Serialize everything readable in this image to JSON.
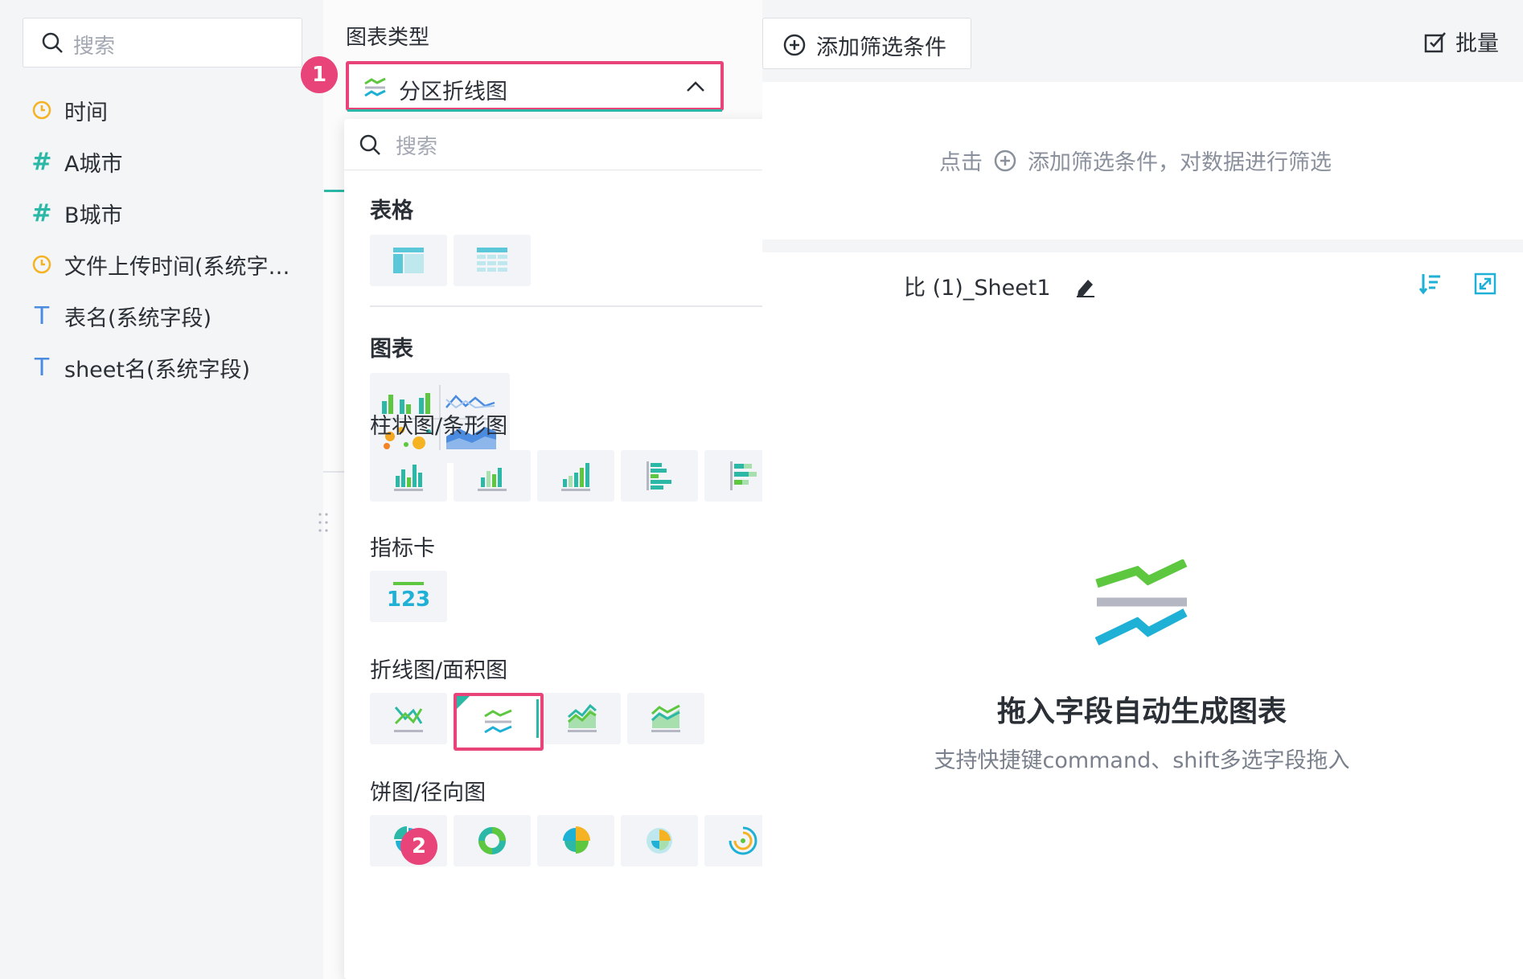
{
  "field_panel": {
    "search_placeholder": "搜索",
    "fields": [
      {
        "label": "时间",
        "icon": "clock-icon",
        "type": "date"
      },
      {
        "label": "A城市",
        "icon": "hash-icon",
        "type": "number"
      },
      {
        "label": "B城市",
        "icon": "hash-icon",
        "type": "number"
      },
      {
        "label": "文件上传时间(系统字…",
        "icon": "clock-icon",
        "type": "date"
      },
      {
        "label": "表名(系统字段)",
        "icon": "text-icon",
        "type": "text"
      },
      {
        "label": "sheet名(系统字段)",
        "icon": "text-icon",
        "type": "text"
      }
    ]
  },
  "chart_type": {
    "label": "图表类型",
    "selected": "分区折线图",
    "step1_badge": "1",
    "step2_badge": "2"
  },
  "dropdown": {
    "search_placeholder": "搜索",
    "sections": {
      "table": "表格",
      "chart": "图表",
      "bar": "柱状图/条形图",
      "kpi": "指标卡",
      "line": "折线图/面积图",
      "pie": "饼图/径向图"
    },
    "kpi_tile_text": "123"
  },
  "toolbar": {
    "add_filter": "添加筛选条件",
    "batch": "批量"
  },
  "filter_hint": {
    "prefix": "点击",
    "suffix": "添加筛选条件，对数据进行筛选"
  },
  "canvas": {
    "sheet_title": "比 (1)_Sheet1",
    "empty_title": "拖入字段自动生成图表",
    "empty_subtitle": "支持快捷键command、shift多选字段拖入"
  },
  "colors": {
    "accent": "#2bb8a6",
    "highlight": "#e8447a",
    "line_green": "#5ec740",
    "line_blue": "#1fb0d6",
    "mid_gray": "#b5b8c3"
  }
}
